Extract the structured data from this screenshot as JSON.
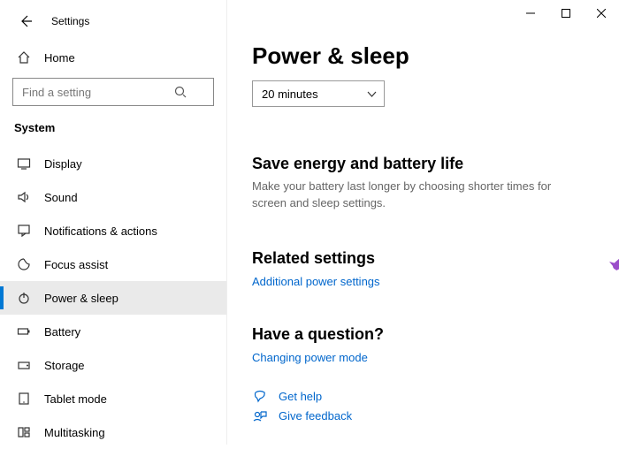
{
  "window": {
    "app_title": "Settings"
  },
  "sidebar": {
    "home_label": "Home",
    "search_placeholder": "Find a setting",
    "section_label": "System",
    "items": [
      {
        "label": "Display"
      },
      {
        "label": "Sound"
      },
      {
        "label": "Notifications & actions"
      },
      {
        "label": "Focus assist"
      },
      {
        "label": "Power & sleep"
      },
      {
        "label": "Battery"
      },
      {
        "label": "Storage"
      },
      {
        "label": "Tablet mode"
      },
      {
        "label": "Multitasking"
      }
    ]
  },
  "main": {
    "page_title": "Power & sleep",
    "dropdown_value": "20 minutes",
    "save_energy": {
      "heading": "Save energy and battery life",
      "text": "Make your battery last longer by choosing shorter times for screen and sleep settings."
    },
    "related": {
      "heading": "Related settings",
      "link": "Additional power settings"
    },
    "question": {
      "heading": "Have a question?",
      "link": "Changing power mode"
    },
    "help": {
      "get_help": "Get help",
      "feedback": "Give feedback"
    }
  }
}
